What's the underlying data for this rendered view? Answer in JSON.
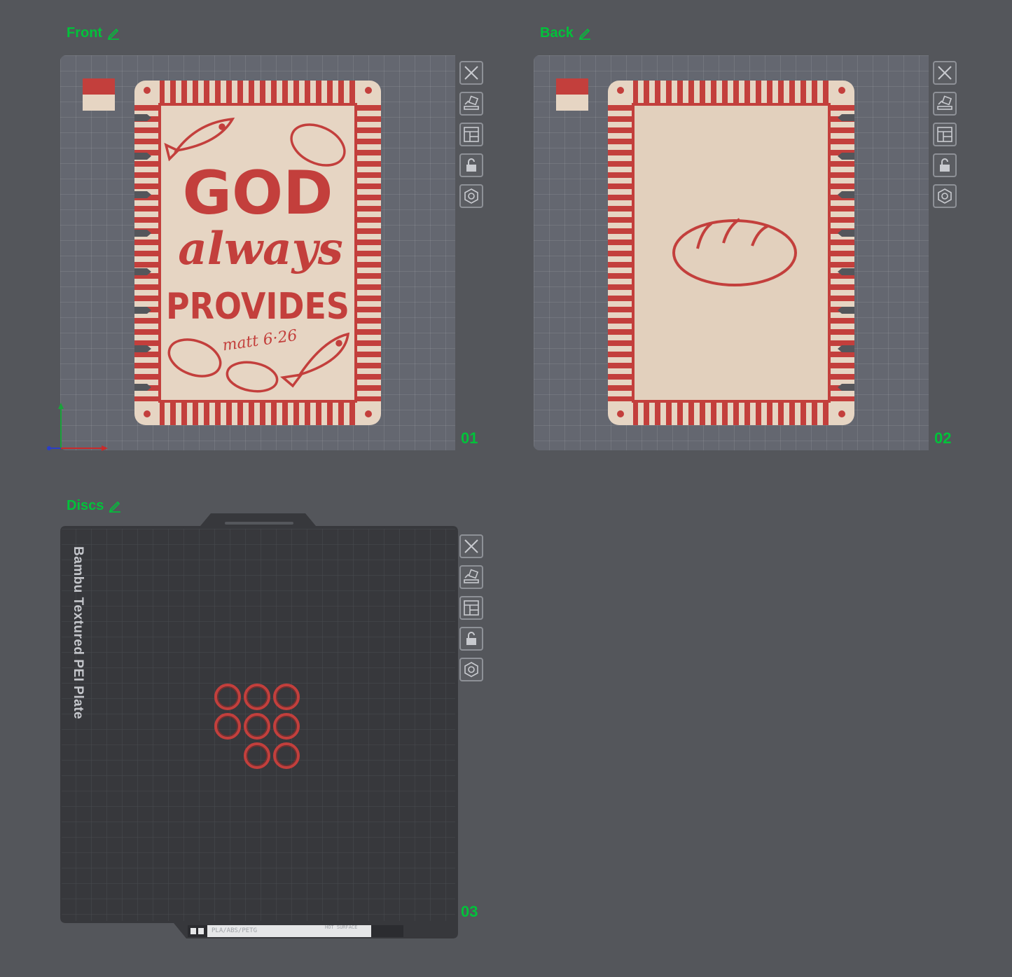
{
  "plates": [
    {
      "title": "Front",
      "number": "01"
    },
    {
      "title": "Back",
      "number": "02"
    },
    {
      "title": "Discs",
      "number": "03"
    }
  ],
  "front_card": {
    "line1": "GOD",
    "line2": "always",
    "line3": "PROVIDES",
    "verse": "matt 6·26"
  },
  "textured_plate": {
    "label": "Bambu Textured PEI Plate",
    "footer_material": "PLA/ABS/PETG",
    "footer_warning": "HOT SURFACE"
  },
  "icons": {
    "close": "close-icon",
    "auto_orient": "auto-orient-icon",
    "arrange": "arrange-icon",
    "lock": "lock-icon",
    "settings": "settings-icon",
    "edit": "pencil-icon"
  },
  "colors": {
    "label_green": "#00c23a",
    "card_red": "#c33f3c",
    "card_cream": "#e6d5c3",
    "bed_gray": "#646770",
    "background": "#54565b"
  },
  "filament_swatch": [
    "#c33f3c",
    "#e6d5c3"
  ],
  "disc_count": 8
}
